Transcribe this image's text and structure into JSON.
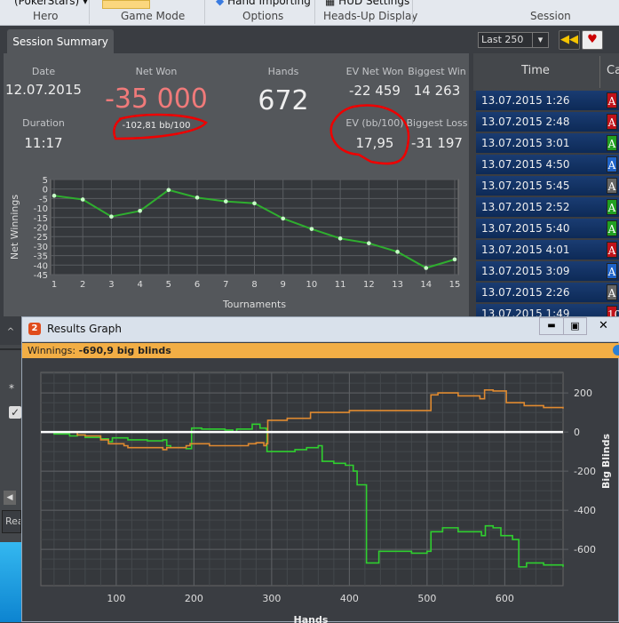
{
  "ribbon": {
    "hero_value": "(PokerStars) ▾",
    "options_item": "Hand Importing",
    "hud_item": "HUD Settings",
    "groups": [
      "Hero",
      "Game Mode",
      "Options",
      "Heads-Up Display",
      "Session"
    ]
  },
  "summary": {
    "tab": "Session Summary",
    "date_label": "Date",
    "date": "12.07.2015",
    "duration_label": "Duration",
    "duration": "11:17",
    "net_won_label": "Net Won",
    "net_won": "-35 000",
    "bb100": "-102,81 bb/100",
    "hands_label": "Hands",
    "hands": "672",
    "ev_net_won_label": "EV Net Won",
    "ev_net_won": "-22 459",
    "biggest_win_label": "Biggest Win",
    "biggest_win": "14 263",
    "ev_bb100_label": "EV (bb/100)",
    "ev_bb100": "17,95",
    "biggest_loss_label": "Biggest Loss",
    "biggest_loss": "-31 197"
  },
  "sessions": {
    "filter": "Last 250",
    "col_time": "Time",
    "col_cards": "Ca",
    "rows": [
      {
        "time": "13.07.2015 1:26",
        "card": "A",
        "color": "#c0121a"
      },
      {
        "time": "13.07.2015 2:48",
        "card": "A",
        "color": "#c0121a"
      },
      {
        "time": "13.07.2015 3:01",
        "card": "A",
        "color": "#22a022"
      },
      {
        "time": "13.07.2015 4:50",
        "card": "A",
        "color": "#1f63c8"
      },
      {
        "time": "13.07.2015 5:45",
        "card": "A",
        "color": "#666666"
      },
      {
        "time": "13.07.2015 2:52",
        "card": "A",
        "color": "#22a022"
      },
      {
        "time": "13.07.2015 5:40",
        "card": "A",
        "color": "#22a022"
      },
      {
        "time": "13.07.2015 4:01",
        "card": "A",
        "color": "#c0121a"
      },
      {
        "time": "13.07.2015 3:09",
        "card": "A",
        "color": "#1f63c8"
      },
      {
        "time": "13.07.2015 2:26",
        "card": "A",
        "color": "#666666"
      },
      {
        "time": "13.07.2015 1:49",
        "card": "10",
        "color": "#c0121a"
      }
    ]
  },
  "left": {
    "star": "*",
    "read": "Rea"
  },
  "results": {
    "title": "Results Graph",
    "winnings_label": "Winnings:",
    "winnings_value": "-690,9 big blinds"
  },
  "chart_data": [
    {
      "type": "line",
      "xlabel": "Tournaments",
      "ylabel": "Net Winnings",
      "ylim": [
        -45,
        5
      ],
      "yticks": [
        5,
        0,
        -5,
        -10,
        -15,
        -20,
        -25,
        -30,
        -35,
        -40,
        -45
      ],
      "x": [
        1,
        2,
        3,
        4,
        5,
        6,
        7,
        8,
        9,
        10,
        11,
        12,
        13,
        14,
        15
      ],
      "values": [
        -3.5,
        -5.5,
        -14.5,
        -11.5,
        -0.5,
        -4.5,
        -6.5,
        -7.5,
        -15.5,
        -21,
        -26,
        -28.5,
        -33,
        -41.5,
        -37
      ],
      "color": "#2fae2f",
      "grid": true
    },
    {
      "type": "line",
      "xlabel": "Hands",
      "ylabel": "Big Blinds",
      "xticks": [
        100,
        200,
        300,
        400,
        500,
        600
      ],
      "yticks": [
        200,
        0,
        -200,
        -400,
        -600
      ],
      "xlim": [
        3,
        675
      ],
      "ylim": [
        -786,
        305
      ],
      "grid": true,
      "series": [
        {
          "color": "#2fcf2f",
          "points": [
            [
              0,
              0
            ],
            [
              20,
              -10
            ],
            [
              40,
              -20
            ],
            [
              50,
              -15
            ],
            [
              60,
              -28
            ],
            [
              80,
              -35
            ],
            [
              90,
              -50
            ],
            [
              95,
              -30
            ],
            [
              110,
              -30
            ],
            [
              115,
              -40
            ],
            [
              140,
              -45
            ],
            [
              155,
              -45
            ],
            [
              160,
              -40
            ],
            [
              165,
              -70
            ],
            [
              170,
              -80
            ],
            [
              190,
              -85
            ],
            [
              195,
              -85
            ],
            [
              197,
              20
            ],
            [
              210,
              15
            ],
            [
              240,
              10
            ],
            [
              250,
              0
            ],
            [
              255,
              15
            ],
            [
              270,
              15
            ],
            [
              275,
              40
            ],
            [
              285,
              20
            ],
            [
              293,
              15
            ],
            [
              294,
              -100
            ],
            [
              330,
              -90
            ],
            [
              345,
              -80
            ],
            [
              360,
              -70
            ],
            [
              365,
              -150
            ],
            [
              380,
              -160
            ],
            [
              395,
              -170
            ],
            [
              405,
              -200
            ],
            [
              410,
              -270
            ],
            [
              418,
              -270
            ],
            [
              422,
              -670
            ],
            [
              435,
              -670
            ],
            [
              438,
              -610
            ],
            [
              460,
              -610
            ],
            [
              480,
              -620
            ],
            [
              500,
              -610
            ],
            [
              505,
              -510
            ],
            [
              520,
              -490
            ],
            [
              540,
              -510
            ],
            [
              570,
              -530
            ],
            [
              575,
              -480
            ],
            [
              585,
              -490
            ],
            [
              595,
              -530
            ],
            [
              610,
              -550
            ],
            [
              615,
              -550
            ],
            [
              618,
              -690
            ],
            [
              625,
              -690
            ],
            [
              628,
              -670
            ],
            [
              650,
              -680
            ],
            [
              670,
              -680
            ],
            [
              675,
              -690
            ]
          ]
        },
        {
          "color": "#e08a30",
          "points": [
            [
              0,
              0
            ],
            [
              50,
              -15
            ],
            [
              60,
              -20
            ],
            [
              80,
              -40
            ],
            [
              90,
              -60
            ],
            [
              110,
              -70
            ],
            [
              115,
              -80
            ],
            [
              160,
              -90
            ],
            [
              165,
              -80
            ],
            [
              190,
              -70
            ],
            [
              195,
              -60
            ],
            [
              220,
              -70
            ],
            [
              270,
              -60
            ],
            [
              280,
              -55
            ],
            [
              290,
              -70
            ],
            [
              293,
              -60
            ],
            [
              295,
              60
            ],
            [
              320,
              70
            ],
            [
              350,
              100
            ],
            [
              400,
              110
            ],
            [
              480,
              110
            ],
            [
              503,
              110
            ],
            [
              505,
              190
            ],
            [
              514,
              200
            ],
            [
              540,
              185
            ],
            [
              568,
              170
            ],
            [
              574,
              215
            ],
            [
              585,
              210
            ],
            [
              602,
              150
            ],
            [
              625,
              135
            ],
            [
              650,
              125
            ],
            [
              675,
              120
            ]
          ]
        },
        {
          "color": "#ffffff",
          "points": [
            [
              3,
              0
            ],
            [
              675,
              0
            ]
          ]
        }
      ]
    }
  ]
}
